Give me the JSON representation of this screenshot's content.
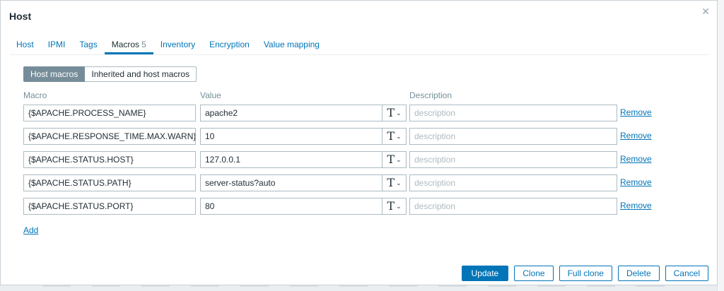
{
  "dialog": {
    "title": "Host",
    "close_icon": "close-icon"
  },
  "tabs": [
    {
      "label": "Host",
      "count": ""
    },
    {
      "label": "IPMI",
      "count": ""
    },
    {
      "label": "Tags",
      "count": ""
    },
    {
      "label": "Macros",
      "count": "5",
      "active": true
    },
    {
      "label": "Inventory",
      "count": ""
    },
    {
      "label": "Encryption",
      "count": ""
    },
    {
      "label": "Value mapping",
      "count": ""
    }
  ],
  "segments": {
    "host_macros": "Host macros",
    "inherited": "Inherited and host macros"
  },
  "columns": {
    "macro": "Macro",
    "value": "Value",
    "description": "Description"
  },
  "macros": [
    {
      "macro": "{$APACHE.PROCESS_NAME}",
      "value": "apache2",
      "description_placeholder": "description",
      "type_label": "T",
      "remove": "Remove"
    },
    {
      "macro": "{$APACHE.RESPONSE_TIME.MAX.WARN}",
      "value": "10",
      "description_placeholder": "description",
      "type_label": "T",
      "remove": "Remove"
    },
    {
      "macro": "{$APACHE.STATUS.HOST}",
      "value": "127.0.0.1",
      "description_placeholder": "description",
      "type_label": "T",
      "remove": "Remove"
    },
    {
      "macro": "{$APACHE.STATUS.PATH}",
      "value": "server-status?auto",
      "description_placeholder": "description",
      "type_label": "T",
      "remove": "Remove"
    },
    {
      "macro": "{$APACHE.STATUS.PORT}",
      "value": "80",
      "description_placeholder": "description",
      "type_label": "T",
      "remove": "Remove"
    }
  ],
  "add_label": "Add",
  "footer": {
    "update": "Update",
    "clone": "Clone",
    "full_clone": "Full clone",
    "delete": "Delete",
    "cancel": "Cancel"
  },
  "colors": {
    "accent": "#0275b8",
    "muted": "#768d99",
    "border": "#acbbc2"
  }
}
